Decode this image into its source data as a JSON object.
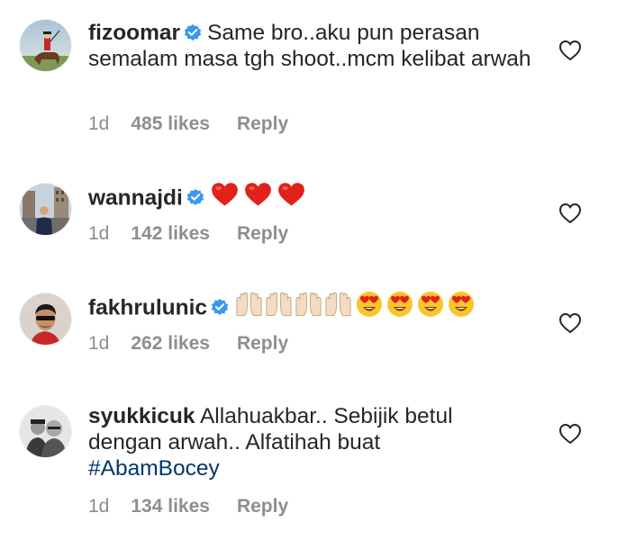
{
  "comments": [
    {
      "username": "fizoomar",
      "text": "Same bro..aku pun perasan semalam masa tgh shoot..mcm kelibat arwah",
      "time": "1d",
      "likes": "485 likes",
      "reply": "Reply",
      "avatar": "rider-on-horse-avatar"
    },
    {
      "username": "wannajdi",
      "emojis": [
        "red-heart",
        "red-heart",
        "red-heart"
      ],
      "time": "1d",
      "likes": "142 likes",
      "reply": "Reply",
      "avatar": "city-street-avatar"
    },
    {
      "username": "fakhrulunic",
      "emojis": [
        "raising-hands",
        "raising-hands",
        "raising-hands",
        "raising-hands",
        "heart-eyes",
        "heart-eyes",
        "heart-eyes",
        "heart-eyes"
      ],
      "time": "1d",
      "likes": "262 likes",
      "reply": "Reply",
      "avatar": "man-with-sunglasses-avatar"
    },
    {
      "username": "syukkicuk",
      "text_line1": "Allahuakbar.. Sebijik betul",
      "text_line2": "dengan arwah.. Alfatihah buat",
      "hashtag": "#AbamBocey",
      "time": "1d",
      "likes": "134 likes",
      "reply": "Reply",
      "avatar": "two-men-avatar"
    }
  ],
  "colors": {
    "text": "#262626",
    "meta": "#8e8e8e",
    "verified": "#3897f0",
    "hashtag": "#00376b"
  },
  "icons": {
    "verified": "verified-badge-icon",
    "like": "heart-outline-icon"
  }
}
